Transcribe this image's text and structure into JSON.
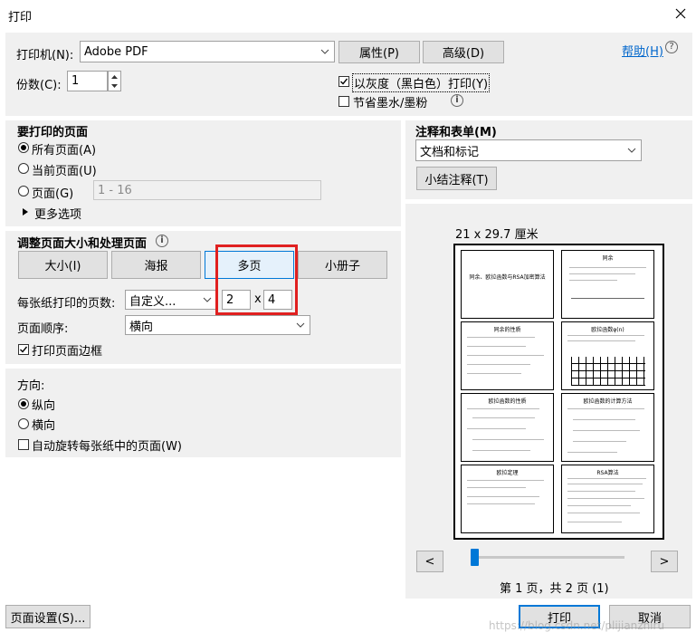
{
  "window": {
    "title": "打印"
  },
  "printer": {
    "label": "打印机(N):",
    "value": "Adobe PDF",
    "properties_btn": "属性(P)",
    "advanced_btn": "高级(D)",
    "help_link": "帮助(H)",
    "copies_label": "份数(C):",
    "copies_value": "1",
    "grayscale_label": "以灰度（黑白色）打印(Y)",
    "grayscale_checked": true,
    "save_ink_label": "节省墨水/墨粉",
    "save_ink_checked": false
  },
  "pages": {
    "title": "要打印的页面",
    "all_label": "所有页面(A)",
    "current_label": "当前页面(U)",
    "pages_label": "页面(G)",
    "pages_range": "1 - 16",
    "more_label": "更多选项",
    "selected": "all"
  },
  "comments": {
    "title": "注释和表单(M)",
    "select_value": "文档和标记",
    "summarize_btn": "小结注释(T)"
  },
  "sizing": {
    "title": "调整页面大小和处理页面",
    "tabs": [
      "大小(I)",
      "海报",
      "多页",
      "小册子"
    ],
    "active_tab": "多页",
    "pages_per_sheet_label": "每张纸打印的页数:",
    "pages_per_sheet_value": "自定义...",
    "cols": "2",
    "rows": "4",
    "x_sep": "x",
    "page_order_label": "页面顺序:",
    "page_order_value": "横向",
    "print_border_label": "打印页面边框",
    "print_border_checked": true
  },
  "orientation": {
    "title": "方向:",
    "portrait_label": "纵向",
    "landscape_label": "横向",
    "auto_rotate_label": "自动旋转每张纸中的页面(W)",
    "selected": "portrait"
  },
  "preview": {
    "size_label": "21 x 29.7 厘米",
    "page_info": "第 1 页，共 2 页 (1)",
    "thumbnails": [
      "同余、欧拉函数与RSA加密算法",
      "同余",
      "同余的性质",
      "欧拉函数φ(n)",
      "欧拉函数的性质",
      "欧拉函数的计算方法",
      "欧拉定理",
      "RSA算法"
    ]
  },
  "footer": {
    "page_setup_btn": "页面设置(S)...",
    "print_btn": "打印",
    "cancel_btn": "取消",
    "watermark": "https://blog.csdn.net/plijianzhiru"
  },
  "colors": {
    "highlight_box": "#e02020",
    "accent": "#0078d7",
    "panel_bg": "#f0f0f0"
  }
}
